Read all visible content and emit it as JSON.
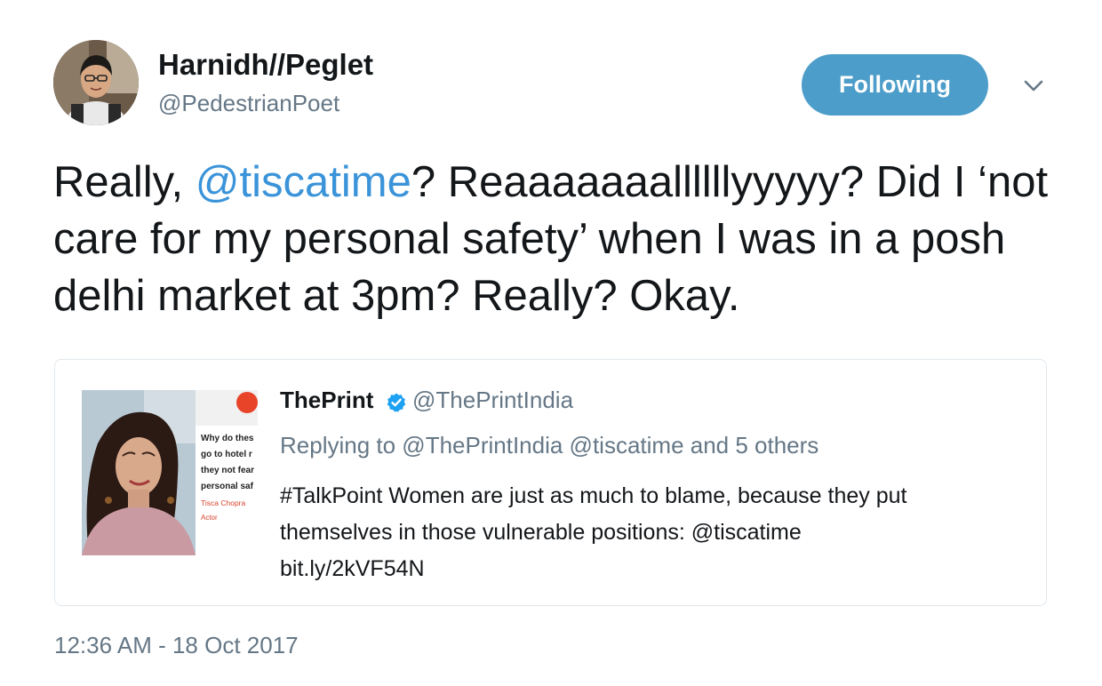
{
  "author": {
    "name": "Harnidh//Peglet",
    "handle": "@PedestrianPoet",
    "follow_label": "Following"
  },
  "tweet": {
    "text_1": "Really, ",
    "mention": "@tiscatime",
    "text_2": "? Reaaaaaaallllllyyyyy? Did I ‘not care for my personal safety’ when I was in a posh delhi market at 3pm? Really? Okay."
  },
  "quoted": {
    "name": "ThePrint",
    "handle": "@ThePrintIndia",
    "replying": "Replying to @ThePrintIndia @tiscatime and 5 others",
    "text_line_1": "#TalkPoint Women are just as much to blame, because they put",
    "text_line_2": "themselves in those vulnerable positions: @tiscatime",
    "text_line_3": "bit.ly/2kVF54N",
    "media": {
      "lines": [
        "Why do thes",
        "go to hotel r",
        "they not fear",
        "personal saf"
      ],
      "person_name": "Tisca Chopra",
      "person_role": "Actor"
    }
  },
  "timestamp": "12:36 AM - 18 Oct 2017",
  "colors": {
    "follow_button": "#4c9dc9",
    "mention": "#3b94d9",
    "secondary_text": "#657786",
    "verified": "#1da1f2",
    "brand_red": "#e8442a"
  },
  "icons": {
    "verified": "verified-badge-icon",
    "chevron": "chevron-down-icon"
  }
}
